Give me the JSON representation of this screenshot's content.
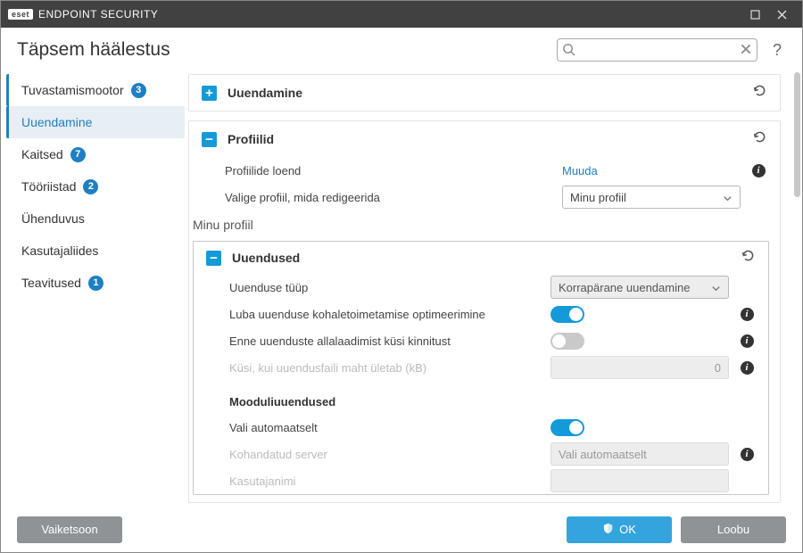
{
  "titlebar": {
    "brand_tag": "eset",
    "brand_text": "ENDPOINT SECURITY"
  },
  "header": {
    "title": "Täpsem häälestus",
    "search_placeholder": "",
    "help": "?"
  },
  "sidebar": {
    "items": [
      {
        "label": "Tuvastamismootor",
        "badge": "3"
      },
      {
        "label": "Uuendamine",
        "badge": ""
      },
      {
        "label": "Kaitsed",
        "badge": "7"
      },
      {
        "label": "Tööriistad",
        "badge": "2"
      },
      {
        "label": "Ühenduvus",
        "badge": ""
      },
      {
        "label": "Kasutajaliides",
        "badge": ""
      },
      {
        "label": "Teavitused",
        "badge": "1"
      }
    ]
  },
  "panels": {
    "uuendamine": {
      "title": "Uuendamine"
    },
    "profiilid": {
      "title": "Profiilid",
      "row_list_label": "Profiilide loend",
      "row_list_action": "Muuda",
      "row_select_label": "Valige profiil, mida redigeerida",
      "row_select_value": "Minu profiil",
      "subheading": "Minu profiil"
    },
    "uuendused": {
      "title": "Uuendused",
      "type_label": "Uuenduse tüüp",
      "type_value": "Korrapärane uuendamine",
      "opt_label": "Luba uuenduse kohaletoimetamise optimeerimine",
      "confirm_label": "Enne uuenduste allalaadimist küsi kinnitust",
      "size_label": "Küsi, kui uuendusfaili maht ületab (kB)",
      "size_value": "0",
      "modules_title": "Mooduliuuendused",
      "auto_label": "Vali automaatselt",
      "server_label": "Kohandatud server",
      "server_value": "Vali automaatselt",
      "user_label": "Kasutajanimi"
    }
  },
  "footer": {
    "default": "Vaiketsoon",
    "ok": "OK",
    "cancel": "Loobu"
  }
}
